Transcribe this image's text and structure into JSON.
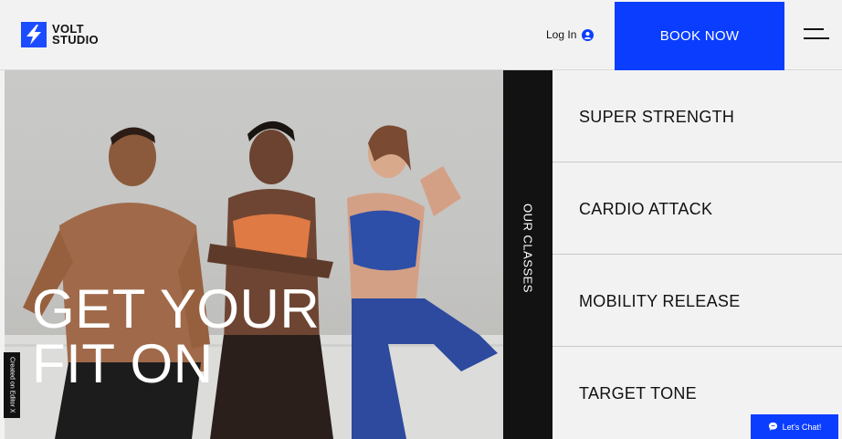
{
  "brand": {
    "line1": "VOLT",
    "line2": "STUDIO",
    "accent": "#1b4cff"
  },
  "header": {
    "login_label": "Log In",
    "login_icon": "user-circle-icon",
    "book_label": "BOOK NOW",
    "menu_icon": "hamburger-menu-icon"
  },
  "hero": {
    "title_line1": "GET YOUR",
    "title_line2": "FIT ON"
  },
  "badge": {
    "label": "Created on Editor X"
  },
  "sidebar": {
    "label": "OUR CLASSES"
  },
  "classes": [
    {
      "label": "SUPER STRENGTH"
    },
    {
      "label": "CARDIO ATTACK"
    },
    {
      "label": "MOBILITY RELEASE"
    },
    {
      "label": "TARGET TONE"
    }
  ],
  "chat": {
    "label": "Let's Chat!",
    "icon": "chat-bubble-icon"
  }
}
